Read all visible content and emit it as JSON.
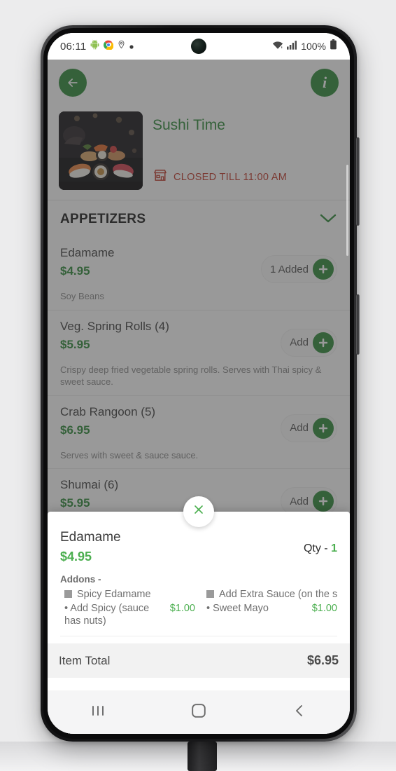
{
  "status_bar": {
    "time": "06:11",
    "battery_percent": "100%",
    "icons": [
      "android-robot-icon",
      "chrome-icon",
      "location-pin-icon",
      "dot-icon",
      "wifi-icon",
      "signal-bars-icon",
      "battery-icon"
    ]
  },
  "app_header": {
    "back_label": "back-arrow",
    "info_label": "i"
  },
  "restaurant": {
    "name": "Sushi Time",
    "status_text": "CLOSED TILL 11:00 AM",
    "status_color": "#c0392b",
    "thumbnail_alt": "sushi-platter-photo"
  },
  "category": {
    "name": "APPETIZERS",
    "expanded": true
  },
  "menu_items": [
    {
      "name": "Edamame",
      "price": "$4.95",
      "description": "Soy Beans",
      "action_label": "1 Added"
    },
    {
      "name": "Veg. Spring Rolls (4)",
      "price": "$5.95",
      "description": "Crispy deep fried vegetable spring rolls. Serves with Thai spicy & sweet sauce.",
      "action_label": "Add"
    },
    {
      "name": "Crab Rangoon (5)",
      "price": "$6.95",
      "description": "Serves with sweet & sauce sauce.",
      "action_label": "Add"
    },
    {
      "name": "Shumai (6)",
      "price": "$5.95",
      "description": "",
      "action_label": "Add"
    }
  ],
  "sheet": {
    "close_label": "×",
    "item_name": "Edamame",
    "item_price": "$4.95",
    "qty_label": "Qty -",
    "qty_value": "1",
    "addons_label": "Addons -",
    "addon_groups": [
      {
        "group_name": "Spicy Edamame",
        "option_name": "• Add Spicy (sauce has nuts)",
        "option_price": "$1.00"
      },
      {
        "group_name": "Add Extra Sauce (on the s…",
        "option_name": "• Sweet Mayo",
        "option_price": "$1.00"
      }
    ],
    "total_label": "Item Total",
    "total_value": "$6.95"
  },
  "nav_bar": {
    "recents_label": "recents-icon",
    "home_label": "home-icon",
    "back_label": "back-icon"
  },
  "colors": {
    "brand_green": "#2e8b3a",
    "price_green": "#4caf50",
    "closed_red": "#c0392b"
  }
}
